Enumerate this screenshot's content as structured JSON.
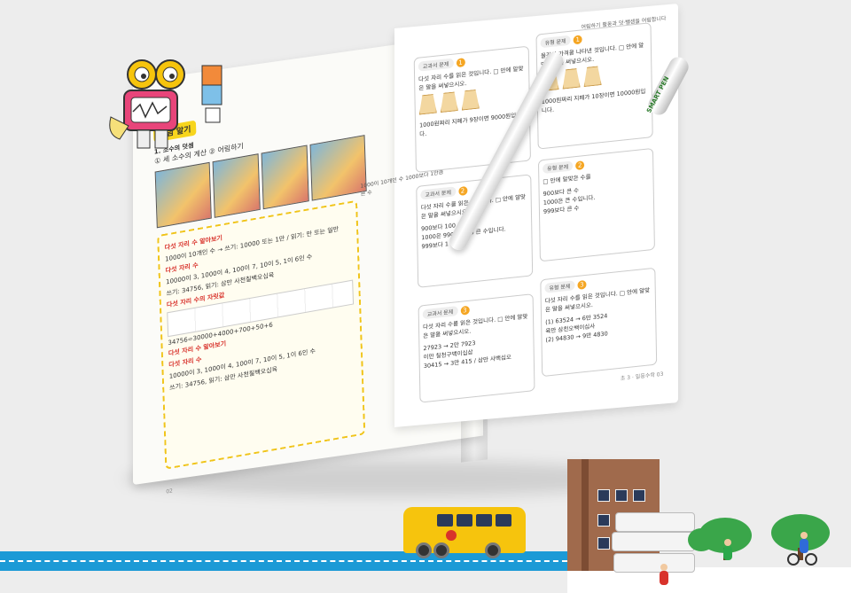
{
  "left_page": {
    "tag": "개념 알기",
    "section": "1. 소수의 덧셈",
    "subtitle": "① 세 소수의 계산 ② 어림하기",
    "corner_tag": "개념",
    "side_note": "1000이 10개인 수\n1000보다 1만큼 큰 수",
    "box_title_1": "다섯 자리 수 알아보기",
    "box_line_1": "1000이 10개인 수 → 쓰기: 10000 또는 1만 / 읽기: 만 또는 일만",
    "box_title_2": "다섯 자리 수",
    "box_line_2": "10000이 3, 1000이 4, 100이 7, 10이 5, 1이 6인 수",
    "box_line_3": "쓰기: 34756, 읽기: 삼만 사천칠백오십육",
    "box_title_3": "다섯 자리 수의 자릿값",
    "box_line_4": "34756=30000+4000+700+50+6",
    "box_title_4": "다섯 자리 수 알아보기",
    "box_title_5": "다섯 자리 수",
    "box_line_5": "10000이 3, 1000이 4, 100이 7, 10이 5, 1이 6인 수",
    "box_line_6": "쓰기: 34756, 읽기: 삼만 사천칠백오십육",
    "page_number": "02"
  },
  "right_page": {
    "header_note": "어림하기 활동과 덧·뺄셈을 어림합니다",
    "q1_title": "교과서 문제",
    "q1_text": "다섯 자리 수를 읽은 것입니다. □ 안에 알맞은 말을 써넣으시오.",
    "q1_answer": "1000원짜리 지폐가 9장이면 9000원입니다.",
    "q2_title": "유형 문제",
    "q2_text": "물건의 가격을 나타낸 것입니다. □ 안에 알맞은 수를 써넣으시오.",
    "q2_answer": "1000원짜리 지폐가 10장이면 10000원입니다.",
    "q3_title": "교과서 문제",
    "q3_text": "다섯 자리 수를 읽은 것입니다. □ 안에 알맞은 말을 써넣으시오.",
    "q3_lines": [
      "900보다 100 큰 수",
      "1000은 990보다 10 큰 수입니다.",
      "999보다 1 큰 수"
    ],
    "q4_title": "유형 문제",
    "q4_text": "□ 안에 알맞은 수를",
    "q4_lines": [
      "900보다 큰 수",
      "1000은 큰 수입니다.",
      "999보다 큰 수"
    ],
    "q5_title": "교과서 문제",
    "q5_text": "다섯 자리 수를 읽은 것입니다. □ 안에 알맞은 말을 써넣으시오.",
    "q5_lines": [
      "27923 → 2만 7923",
      "이만 칠천구백이십삼",
      "30415 → 3만 415 / 삼만 사백십오"
    ],
    "q6_title": "유형 문제",
    "q6_text": "다섯 자리 수를 읽은 것입니다. □ 안에 알맞은 말을 써넣으시오.",
    "q6_lines": [
      "(1) 63524 → 6만 3524",
      "육만 삼천오백이십사",
      "(2) 94830 → 9만 4830"
    ],
    "page_number": "03",
    "page_label": "초 3 · 일등수학"
  },
  "pen": {
    "label": "SMART PEN"
  },
  "colors": {
    "road": "#1c9ad6",
    "bus": "#f6c40d",
    "building": "#a06a4c",
    "tree": "#3aa64a",
    "accent": "#f0c419"
  }
}
